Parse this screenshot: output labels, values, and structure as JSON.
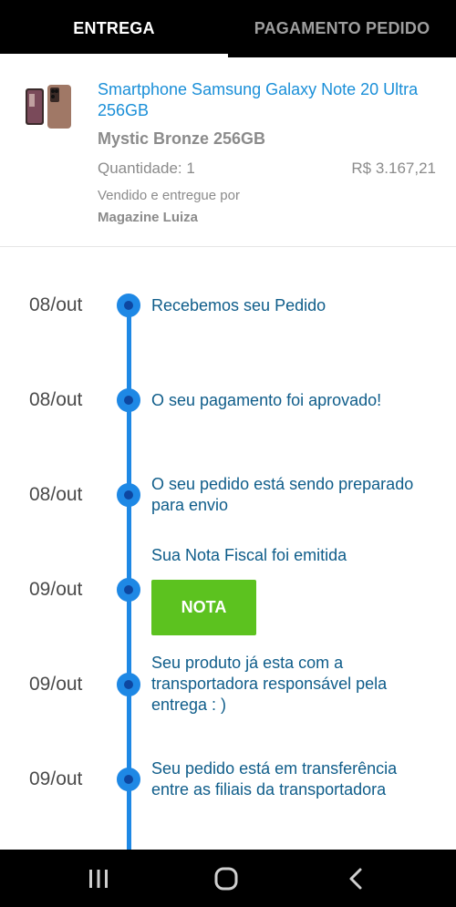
{
  "tabs": {
    "active": "ENTREGA",
    "inactive": "PAGAMENTO PEDIDO"
  },
  "product": {
    "title": "Smartphone Samsung Galaxy Note 20 Ultra 256GB",
    "variant": "Mystic Bronze 256GB",
    "quantity": "Quantidade: 1",
    "price": "R$ 3.167,21",
    "seller_label": "Vendido e entregue por",
    "seller_name": "Magazine Luiza"
  },
  "timeline": [
    {
      "date": "08/out",
      "text": "Recebemos seu Pedido"
    },
    {
      "date": "08/out",
      "text": "O seu pagamento foi aprovado!"
    },
    {
      "date": "08/out",
      "text": "O seu pedido está sendo preparado para envio"
    },
    {
      "date": "09/out",
      "text": "Sua Nota Fiscal foi emitida",
      "button": "NOTA"
    },
    {
      "date": "09/out",
      "text": "Seu produto já esta com a transportadora responsável pela entrega : )"
    },
    {
      "date": "09/out",
      "text": "Seu pedido está em transferência entre as filiais da transportadora"
    }
  ],
  "navbar": {
    "icons": [
      "recent-apps-icon",
      "home-icon",
      "back-icon"
    ]
  },
  "colors": {
    "accent": "#1e88e5",
    "link": "#1a8fd8",
    "timeline_text": "#0f5d8a",
    "nota_button": "#5cc21f",
    "bar_bg": "#000000"
  }
}
